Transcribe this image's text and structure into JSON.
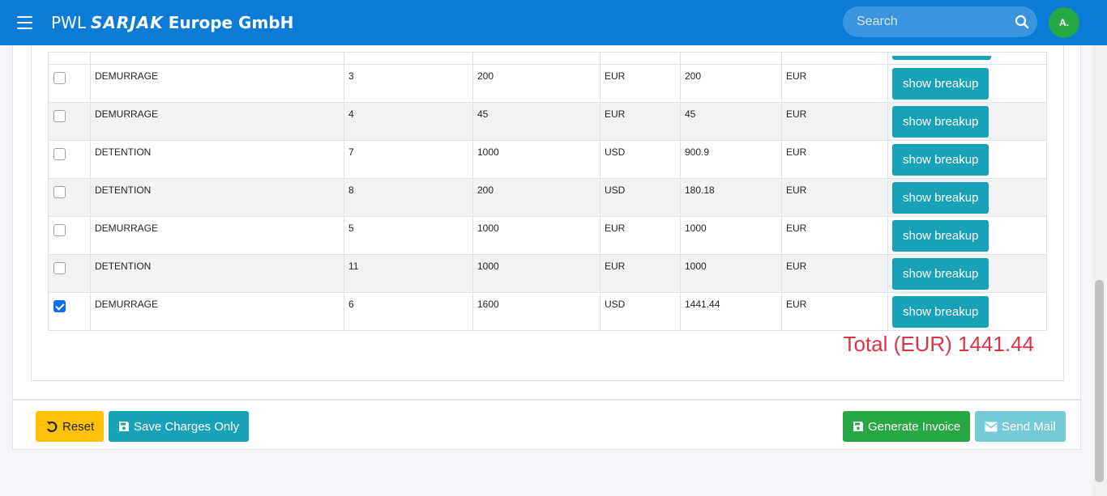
{
  "header": {
    "brand_prefix": "PWL",
    "brand_logo": "SARJAK",
    "brand_suffix": "Europe GmbH",
    "search_placeholder": "Search",
    "avatar_initial": "A."
  },
  "table": {
    "button_label": "show breakup",
    "rows": [
      {
        "checked": false,
        "type": "DEMURRAGE",
        "days": "3",
        "amount": "200",
        "currency": "EUR",
        "converted": "200",
        "converted_currency": "EUR"
      },
      {
        "checked": false,
        "type": "DEMURRAGE",
        "days": "4",
        "amount": "45",
        "currency": "EUR",
        "converted": "45",
        "converted_currency": "EUR"
      },
      {
        "checked": false,
        "type": "DETENTION",
        "days": "7",
        "amount": "1000",
        "currency": "USD",
        "converted": "900.9",
        "converted_currency": "EUR"
      },
      {
        "checked": false,
        "type": "DETENTION",
        "days": "8",
        "amount": "200",
        "currency": "USD",
        "converted": "180.18",
        "converted_currency": "EUR"
      },
      {
        "checked": false,
        "type": "DEMURRAGE",
        "days": "5",
        "amount": "1000",
        "currency": "EUR",
        "converted": "1000",
        "converted_currency": "EUR"
      },
      {
        "checked": false,
        "type": "DETENTION",
        "days": "11",
        "amount": "1000",
        "currency": "EUR",
        "converted": "1000",
        "converted_currency": "EUR"
      },
      {
        "checked": true,
        "type": "DEMURRAGE",
        "days": "6",
        "amount": "1600",
        "currency": "USD",
        "converted": "1441.44",
        "converted_currency": "EUR"
      }
    ]
  },
  "total": "Total (EUR) 1441.44",
  "footer": {
    "reset_label": "Reset",
    "save_label": "Save Charges Only",
    "generate_label": "Generate Invoice",
    "send_label": "Send Mail"
  },
  "colors": {
    "navbar": "#0a7bd6",
    "info": "#17a2b8",
    "warning": "#ffc107",
    "success": "#28a745",
    "danger": "#dc3545"
  },
  "icons": [
    "menu-icon",
    "search-icon",
    "undo-icon",
    "save-icon",
    "envelope-icon",
    "checkmark-icon"
  ]
}
